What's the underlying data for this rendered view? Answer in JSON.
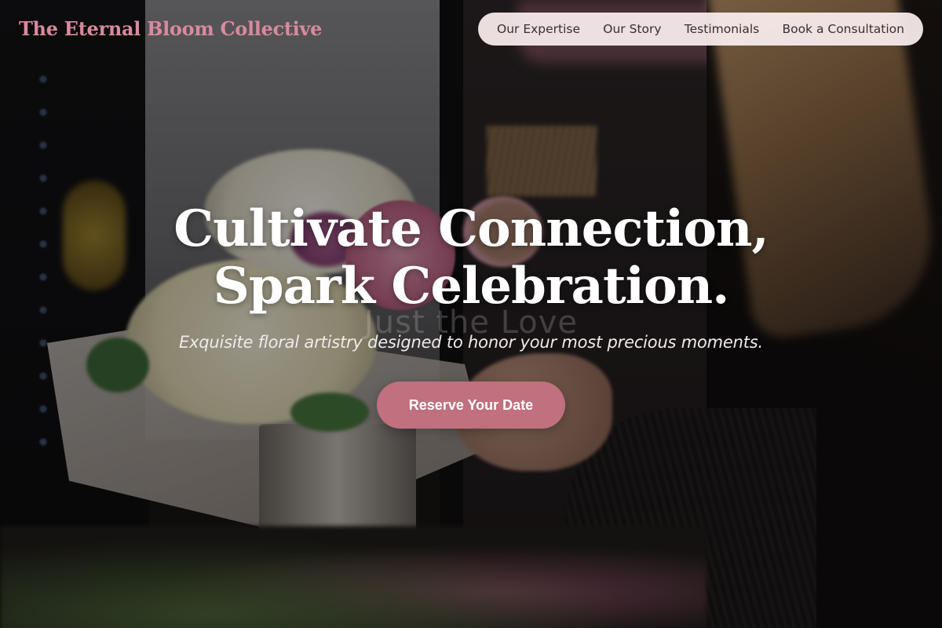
{
  "brand": {
    "name": "The Eternal Bloom Collective",
    "accent": "#d98a9d"
  },
  "nav": {
    "items": [
      {
        "label": "Our Expertise"
      },
      {
        "label": "Our Story"
      },
      {
        "label": "Testimonials"
      },
      {
        "label": "Book a Consultation"
      }
    ],
    "background": "#faeeef"
  },
  "hero": {
    "title_line1": "Cultivate Connection,",
    "title_line2": "Spark Celebration.",
    "watermark": "Just the Love",
    "subtitle": "Exquisite floral artistry designed to honor your most precious moments.",
    "cta_label": "Reserve Your Date",
    "cta_color": "#c0707e",
    "background_image": "florist arranging bouquet"
  }
}
